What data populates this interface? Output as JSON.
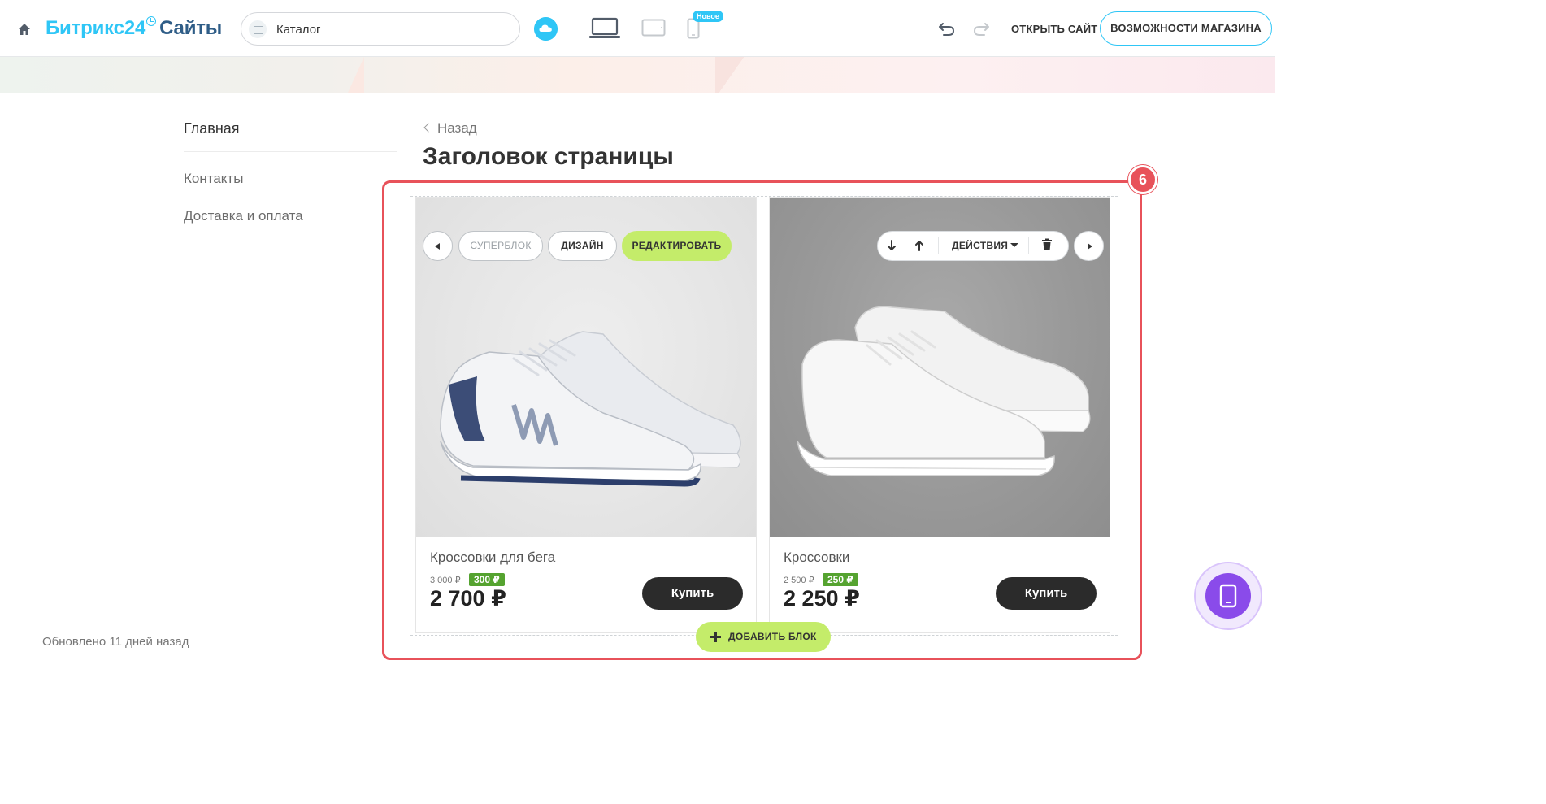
{
  "topbar": {
    "logo_part1": "Битрикс24",
    "logo_part2": "Сайты",
    "page_select_value": "Каталог",
    "new_badge": "Новое",
    "open_site": "ОТКРЫТЬ САЙТ",
    "shop_features": "ВОЗМОЖНОСТИ МАГАЗИНА",
    "icons": [
      "home-icon",
      "cloud-icon",
      "laptop-icon",
      "tablet-icon",
      "phone-icon",
      "undo-icon",
      "redo-icon"
    ],
    "accent_color": "#2fc6f6"
  },
  "menu": {
    "items": [
      "Главная",
      "Контакты",
      "Доставка и оплата"
    ]
  },
  "footer": {
    "updated": "Обновлено 11 дней назад"
  },
  "page": {
    "back": "Назад",
    "title": "Заголовок страницы"
  },
  "highlight": {
    "step": "6",
    "color": "#e8525a"
  },
  "block_toolbar": {
    "superblock": "СУПЕРБЛОК",
    "design": "ДИЗАЙН",
    "edit": "РЕДАКТИРОВАТЬ",
    "actions": "ДЕЙСТВИЯ",
    "add_block": "ДОБАВИТЬ БЛОК",
    "edit_color": "#c4ec6a"
  },
  "products": [
    {
      "name": "Кроссовки для бега",
      "old_price": "3 000 ₽",
      "discount": "300 ₽",
      "price": "2 700 ₽",
      "buy": "Купить"
    },
    {
      "name": "Кроссовки",
      "old_price": "2 500 ₽",
      "discount": "250 ₽",
      "price": "2 250 ₽",
      "buy": "Купить"
    }
  ],
  "floating": {
    "icon": "mobile-preview-icon",
    "color": "#8a4bea"
  }
}
